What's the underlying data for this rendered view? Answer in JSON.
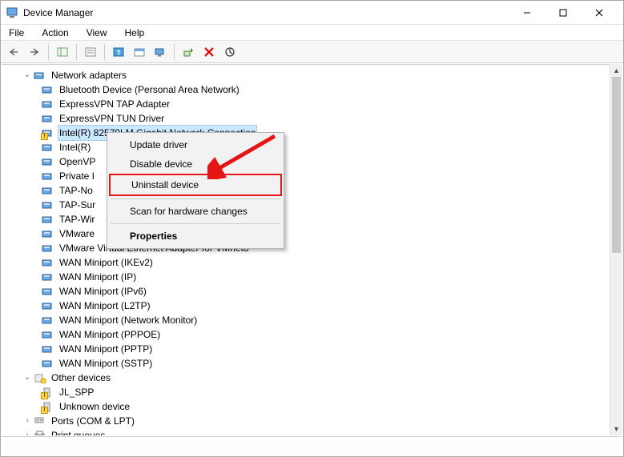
{
  "window": {
    "title": "Device Manager"
  },
  "menu": {
    "file": "File",
    "action": "Action",
    "view": "View",
    "help": "Help"
  },
  "tree": {
    "category": "Network adapters",
    "items": [
      "Bluetooth Device (Personal Area Network)",
      "ExpressVPN TAP Adapter",
      "ExpressVPN TUN Driver",
      "Intel(R) 82579LM Gigabit Network Connection",
      "Intel(R)",
      "OpenVP",
      "Private I",
      "TAP-No",
      "TAP-Sur",
      "TAP-Wir",
      "VMware",
      "VMware Virtual Ethernet Adapter for VMnet8",
      "WAN Miniport (IKEv2)",
      "WAN Miniport (IP)",
      "WAN Miniport (IPv6)",
      "WAN Miniport (L2TP)",
      "WAN Miniport (Network Monitor)",
      "WAN Miniport (PPPOE)",
      "WAN Miniport (PPTP)",
      "WAN Miniport (SSTP)"
    ],
    "other": {
      "label": "Other devices",
      "items": [
        "JL_SPP",
        "Unknown device"
      ]
    },
    "ports": "Ports (COM & LPT)",
    "printq": "Print queues"
  },
  "context_menu": {
    "update": "Update driver",
    "disable": "Disable device",
    "uninstall": "Uninstall device",
    "scan": "Scan for hardware changes",
    "properties": "Properties"
  }
}
